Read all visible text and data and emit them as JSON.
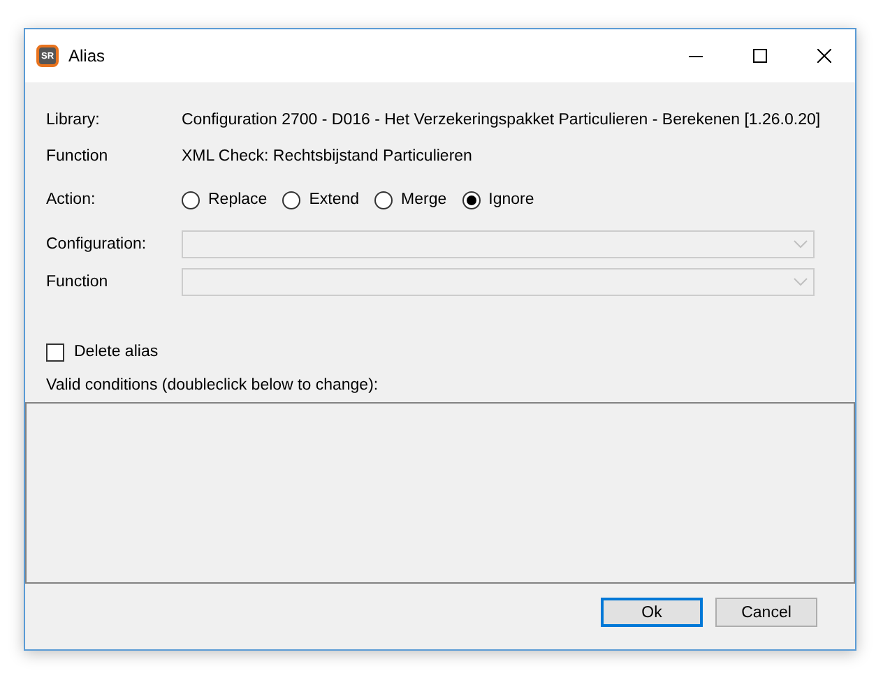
{
  "window": {
    "title": "Alias",
    "icon_text": "SR"
  },
  "fields": [
    {
      "label": "Library:",
      "value": "Configuration 2700 - D016 - Het Verzekeringspakket Particulieren - Berekenen [1.26.0.20]"
    },
    {
      "label": "Function",
      "value": "XML Check: Rechtsbijstand Particulieren"
    }
  ],
  "action": {
    "label": "Action:",
    "options": [
      {
        "label": "Replace",
        "selected": false
      },
      {
        "label": "Extend",
        "selected": false
      },
      {
        "label": "Merge",
        "selected": false
      },
      {
        "label": "Ignore",
        "selected": true
      }
    ]
  },
  "dropdowns": [
    {
      "label": "Configuration:",
      "disabled": true
    },
    {
      "label": "Function",
      "disabled": true
    }
  ],
  "delete_alias": {
    "label": "Delete alias",
    "checked": false
  },
  "conditions": {
    "label": "Valid conditions (doubleclick below to change):"
  },
  "buttons": [
    {
      "label": "Ok",
      "default": true
    },
    {
      "label": "Cancel",
      "default": false
    }
  ]
}
